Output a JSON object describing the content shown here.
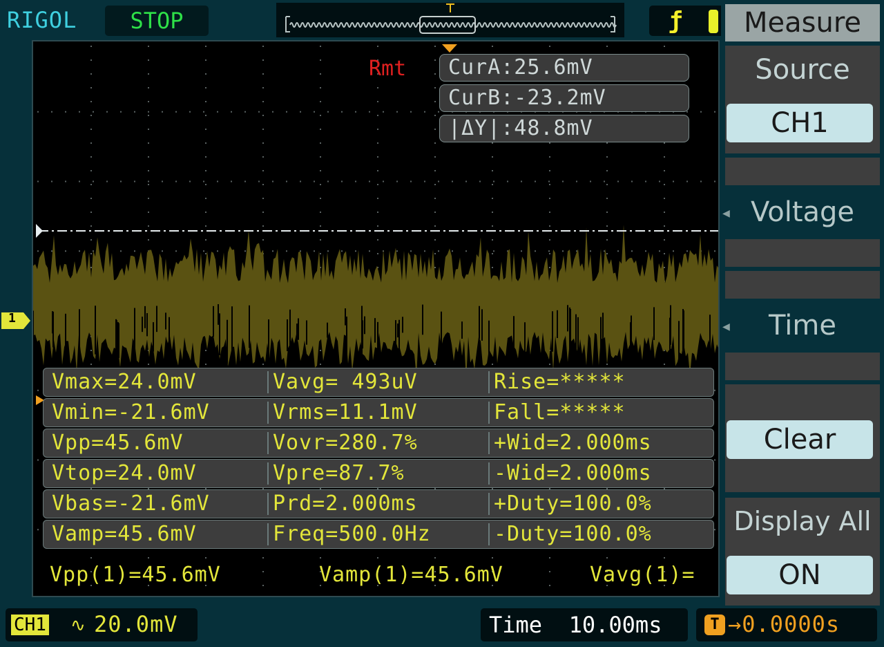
{
  "header": {
    "brand": "RIGOL",
    "run_state": "STOP"
  },
  "remote_indicator": "Rmt",
  "cursors": [
    {
      "label": "CurA:25.6mV"
    },
    {
      "label": "CurB:-23.2mV"
    },
    {
      "label": "|ΔY|:48.8mV"
    }
  ],
  "measurements": [
    [
      "Vmax=24.0mV",
      "Vavg= 493uV",
      "Rise=*****"
    ],
    [
      "Vmin=-21.6mV",
      "Vrms=11.1mV",
      "Fall=*****"
    ],
    [
      "Vpp=45.6mV",
      "Vovr=280.7%",
      "+Wid=2.000ms"
    ],
    [
      "Vtop=24.0mV",
      "Vpre=87.7%",
      "-Wid=2.000ms"
    ],
    [
      "Vbas=-21.6mV",
      "Prd=2.000ms",
      "+Duty=100.0%"
    ],
    [
      "Vamp=45.6mV",
      "Freq=500.0Hz",
      "-Duty=100.0%"
    ]
  ],
  "readouts": [
    "Vpp(1)=45.6mV",
    "Vamp(1)=45.6mV",
    "Vavg(1)="
  ],
  "channel": {
    "marker": "1",
    "name": "CH1",
    "coupling": "∿",
    "scale": "20.0mV"
  },
  "timebase": "Time  10.00ms",
  "trigger": {
    "icon": "T",
    "offset": "→0.0000s"
  },
  "menu": {
    "title": "Measure",
    "source_label": "Source",
    "source_value": "CH1",
    "voltage_label": "Voltage",
    "time_label": "Time",
    "clear_label": "Clear",
    "display_all_label": "Display All",
    "display_all_value": "ON"
  },
  "colors": {
    "trace": "#5a5212",
    "measure_text": "#e3e63a",
    "brand": "#3fd0e0",
    "run_state": "#2ee048",
    "remote": "#e02020",
    "trigger": "#f0a020"
  }
}
